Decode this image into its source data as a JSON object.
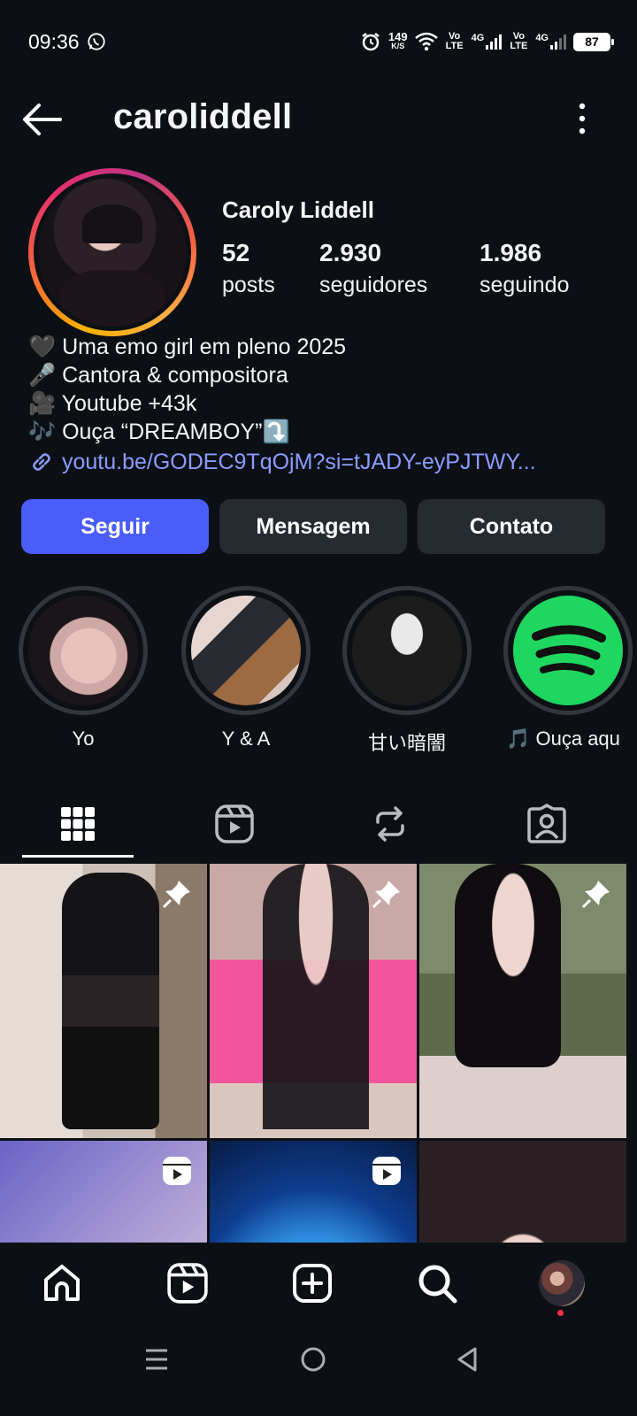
{
  "status_bar": {
    "time": "09:36",
    "speed_value": "149",
    "speed_unit": "K/S",
    "volte1": "Vo\nLTE",
    "net1": "4G",
    "volte2": "Vo\nLTE",
    "net2": "4G",
    "battery": "87"
  },
  "header": {
    "username": "caroliddell"
  },
  "profile": {
    "display_name": "Caroly Liddell",
    "stats": [
      {
        "value": "52",
        "label": "posts"
      },
      {
        "value": "2.930",
        "label": "seguidores"
      },
      {
        "value": "1.986",
        "label": "seguindo"
      }
    ],
    "bio": [
      "🖤 Uma emo girl em pleno 2025",
      "🎤 Cantora & compositora",
      "🎥 Youtube +43k",
      "🎶 Ouça “DREAMBOY”⤵️"
    ],
    "link": "youtu.be/GODEC9TqOjM?si=tJADY-eyPJTWY..."
  },
  "actions": {
    "follow": "Seguir",
    "message": "Mensagem",
    "contact": "Contato"
  },
  "highlights": [
    {
      "label": "Yo"
    },
    {
      "label": "Y & A"
    },
    {
      "label": "甘い暗闇"
    },
    {
      "label": "🎵 Ouça aqu"
    }
  ],
  "tabs": [
    "grid",
    "reels",
    "reposts",
    "tagged"
  ],
  "colors": {
    "background": "#0c1015",
    "accent": "#4a5df9",
    "link": "#8b9cff",
    "button_secondary": "#262a31",
    "spotify": "#1ed760"
  }
}
